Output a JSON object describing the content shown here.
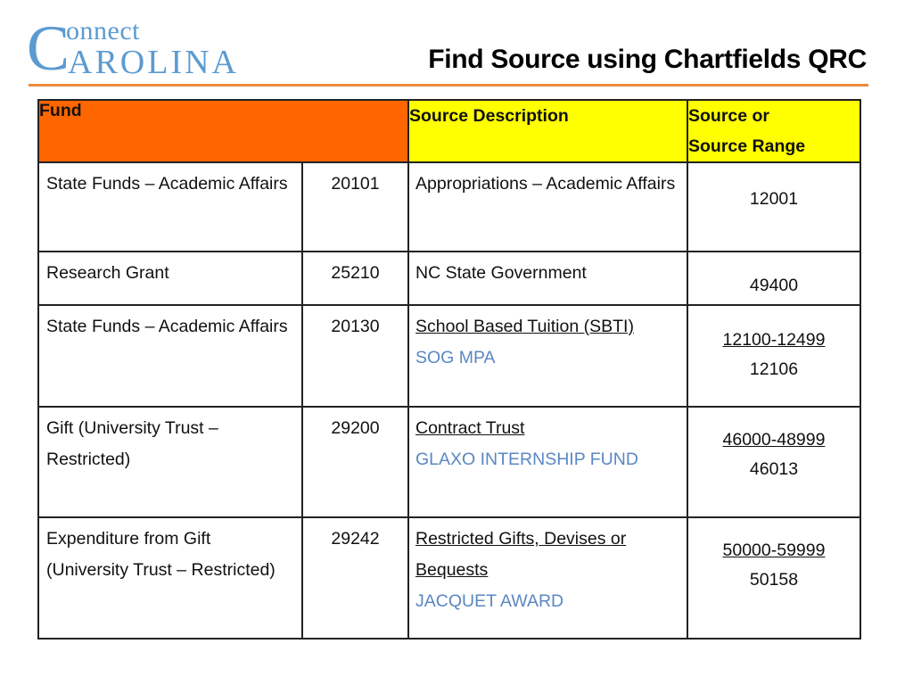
{
  "logo": {
    "initial": "C",
    "line1": "onnect",
    "line2": "AROLINA"
  },
  "title": "Find Source using Chartfields QRC",
  "colors": {
    "logo_blue": "#5b9bd1",
    "rule_orange": "#ed8a3a",
    "fund_header": "#ff6600",
    "source_header": "#ffff00",
    "example_blue": "#5a87c2"
  },
  "table": {
    "headers": {
      "fund": "Fund",
      "source_description": "Source Description",
      "source_range_line1": "Source or",
      "source_range_line2": "Source Range"
    },
    "rows": [
      {
        "fund_name": "State Funds – Academic Affairs",
        "fund_code": "20101",
        "description": "Appropriations – Academic Affairs",
        "example": "",
        "range": "",
        "source": "12001"
      },
      {
        "fund_name": "Research Grant",
        "fund_code": "25210",
        "description": "NC State Government",
        "example": "",
        "range": "",
        "source": "49400"
      },
      {
        "fund_name": "State Funds – Academic Affairs",
        "fund_code": "20130",
        "description": "School Based Tuition (SBTI)",
        "example": "SOG MPA",
        "range": "12100-12499",
        "source": "12106"
      },
      {
        "fund_name": "Gift (University Trust – Restricted)",
        "fund_code": "29200",
        "description": "Contract Trust",
        "example": "GLAXO INTERNSHIP FUND",
        "range": "46000-48999",
        "source": "46013"
      },
      {
        "fund_name": "Expenditure from Gift (University Trust – Restricted)",
        "fund_code": "29242",
        "description": "Restricted Gifts, Devises or Bequests",
        "example": "JACQUET AWARD",
        "range": "50000-59999",
        "source": "50158"
      }
    ]
  }
}
